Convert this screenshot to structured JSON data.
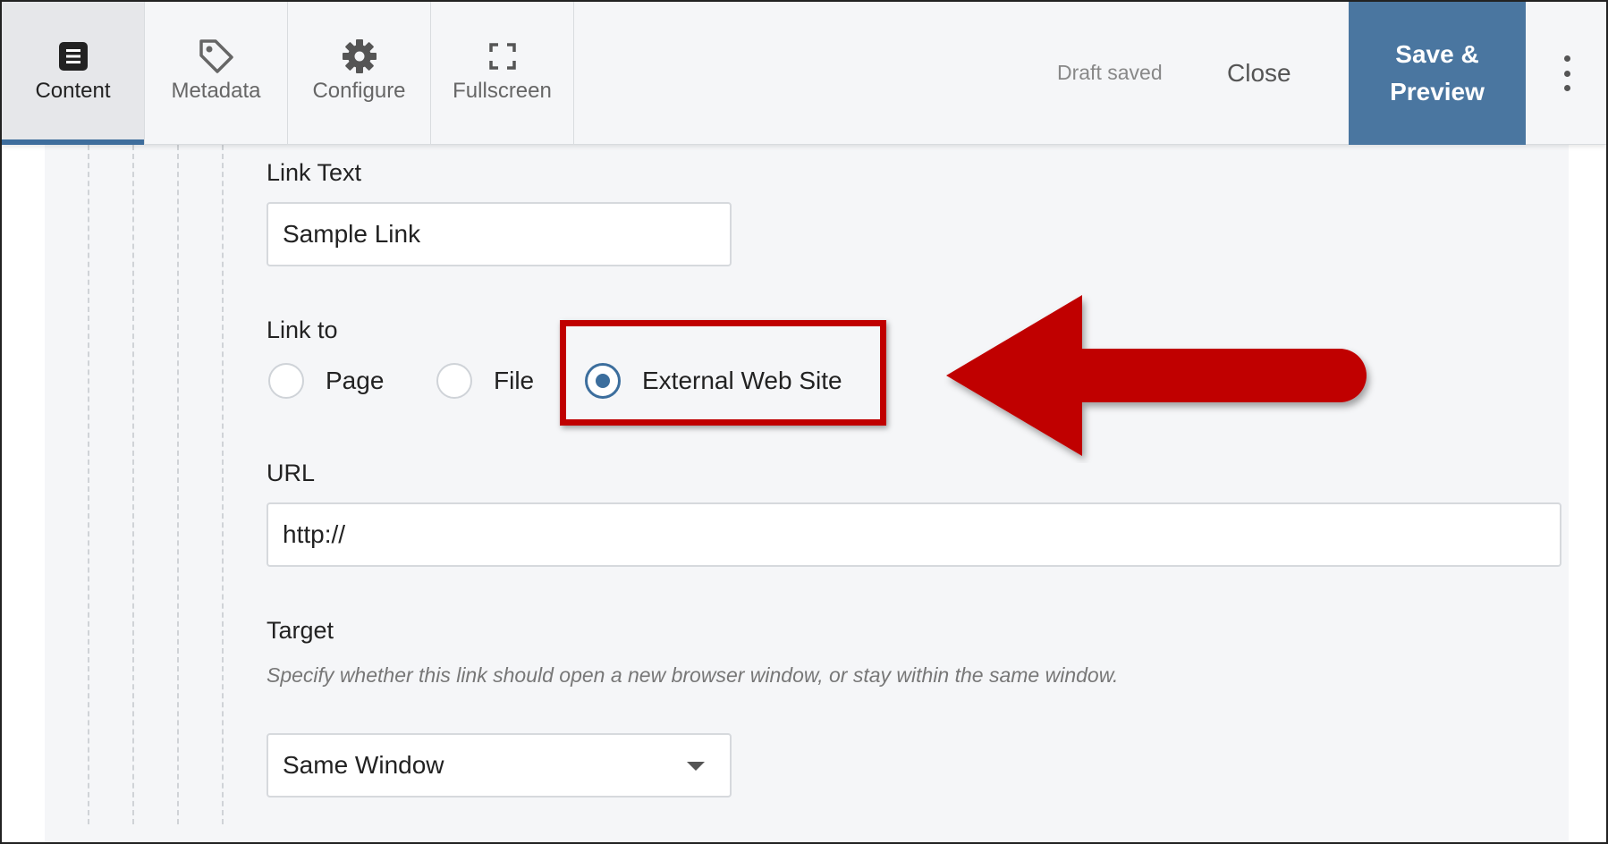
{
  "toolbar": {
    "tabs": [
      {
        "label": "Content",
        "icon": "document-icon",
        "active": true
      },
      {
        "label": "Metadata",
        "icon": "tag-icon",
        "active": false
      },
      {
        "label": "Configure",
        "icon": "gear-icon",
        "active": false
      },
      {
        "label": "Fullscreen",
        "icon": "fullscreen-icon",
        "active": false
      }
    ],
    "draft_status": "Draft saved",
    "close_label": "Close",
    "save_label_line1": "Save &",
    "save_label_line2": "Preview",
    "more_icon": "vertical-ellipsis-icon"
  },
  "form": {
    "link_text": {
      "label": "Link Text",
      "value": "Sample Link"
    },
    "link_to": {
      "label": "Link to",
      "options": [
        {
          "label": "Page",
          "checked": false
        },
        {
          "label": "File",
          "checked": false
        },
        {
          "label": "External Web Site",
          "checked": true
        }
      ]
    },
    "url": {
      "label": "URL",
      "value": "http://"
    },
    "target": {
      "label": "Target",
      "help": "Specify whether this link should open a new browser window, or stay within the same window.",
      "selected": "Same Window"
    }
  },
  "colors": {
    "accent": "#4a76a0",
    "radio_checked": "#3c6e9d",
    "annotation": "#c00000"
  },
  "annotation": {
    "highlight": "red-box",
    "arrow": "red-arrow-pointing-left"
  }
}
